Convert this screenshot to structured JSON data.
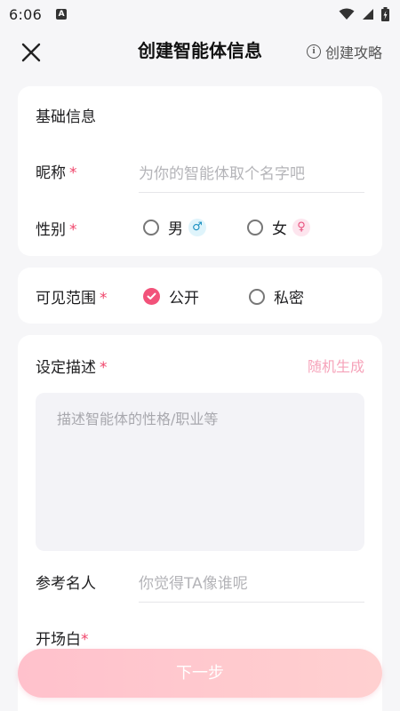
{
  "status_bar": {
    "time": "6:06",
    "notif_letter": "A"
  },
  "header": {
    "title": "创建智能体信息",
    "guide_label": "创建攻略"
  },
  "basic_info": {
    "section_title": "基础信息",
    "nickname_label": "昵称",
    "nickname_placeholder": "为你的智能体取个名字吧",
    "gender_label": "性别",
    "gender_options": [
      {
        "label": "男",
        "symbol": "♂",
        "selected": false
      },
      {
        "label": "女",
        "symbol": "♀",
        "selected": false
      }
    ]
  },
  "visibility": {
    "label": "可见范围",
    "options": [
      {
        "label": "公开",
        "selected": true
      },
      {
        "label": "私密",
        "selected": false
      }
    ]
  },
  "description": {
    "label": "设定描述",
    "random_label": "随机生成",
    "placeholder": "描述智能体的性格/职业等",
    "reference_label": "参考名人",
    "reference_placeholder": "你觉得TA像谁呢",
    "opening_label": "开场白"
  },
  "required_mark": "*",
  "next_button": "下一步",
  "colors": {
    "accent": "#f2527a",
    "required": "#f0456b",
    "button_gradient_start": "#ffc1cc",
    "button_gradient_end": "#ffd0d0"
  },
  "icons": [
    "close-icon",
    "info-icon",
    "male-icon",
    "female-icon",
    "check-icon",
    "wifi-icon",
    "signal-icon",
    "battery-icon"
  ]
}
